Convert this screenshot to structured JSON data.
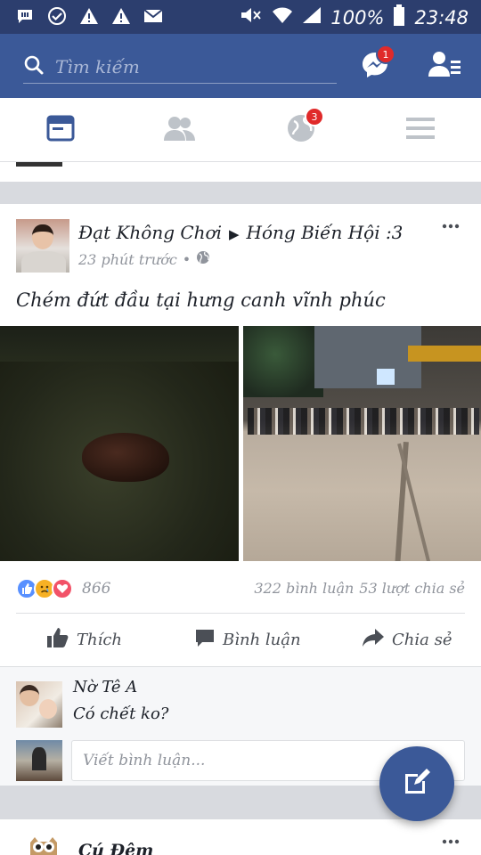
{
  "status_bar": {
    "battery": "100%",
    "time": "23:48",
    "left_icons": [
      "chat-notification-icon",
      "check-circle-icon",
      "warning-icon",
      "warning-icon",
      "mail-icon"
    ],
    "right_icons": [
      "mute-icon",
      "wifi-icon",
      "signal-icon",
      "battery-icon"
    ]
  },
  "header": {
    "search_placeholder": "Tìm kiếm",
    "messenger_badge": "1"
  },
  "tabs": [
    {
      "name": "news-feed",
      "icon": "news-feed-icon",
      "active": true
    },
    {
      "name": "friend-requests",
      "icon": "friends-icon",
      "active": false
    },
    {
      "name": "notifications",
      "icon": "globe-icon",
      "badge": "3",
      "active": false
    },
    {
      "name": "more",
      "icon": "menu-icon",
      "active": false
    }
  ],
  "post": {
    "author": "Đạt Không Chơi",
    "target": "Hóng Biến Hội :3",
    "time": "23 phút trước",
    "text": "Chém đứt đầu tại hưng canh vĩnh phúc",
    "reaction_count": "866",
    "comments_count": "322 bình luận",
    "shares_count": "53 lượt chia sẻ",
    "actions": {
      "like": "Thích",
      "comment": "Bình luận",
      "share": "Chia sẻ"
    },
    "top_comment": {
      "author": "Nờ Tê A",
      "text": "Có chết ko?"
    },
    "comment_placeholder": "Viết bình luận..."
  },
  "next_post": {
    "author": "Cú Đêm"
  },
  "colors": {
    "brand": "#3b5998",
    "status_bar": "#2c3e6e",
    "badge": "#e02a2a",
    "like_blue": "#5890ff",
    "love_red": "#f25268",
    "sad_yellow": "#f7b125"
  }
}
